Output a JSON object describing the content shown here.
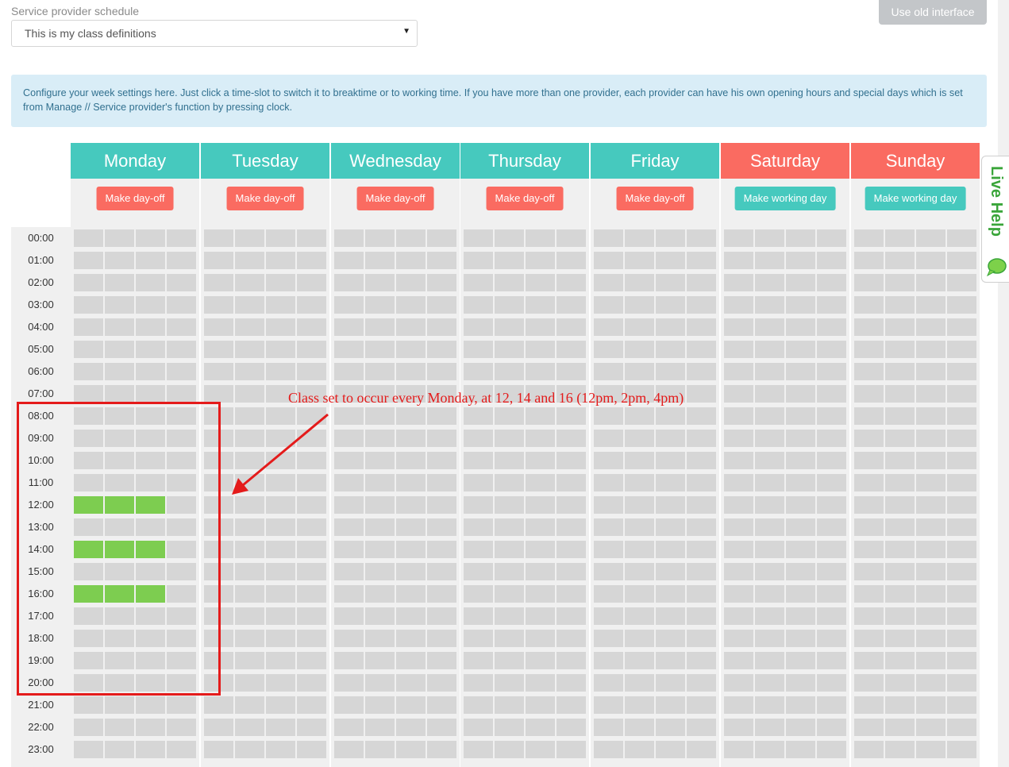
{
  "provider_field": {
    "label": "Service provider schedule",
    "selected": "This is my class definitions"
  },
  "top_button": "Use old interface",
  "info_text": "Configure your week settings here. Just click a time-slot to switch it to breaktime or to working time. If you have more than one provider, each provider can have his own opening hours and special days which is set from Manage // Service provider's function by pressing clock.",
  "times": [
    "00:00",
    "01:00",
    "02:00",
    "03:00",
    "04:00",
    "05:00",
    "06:00",
    "07:00",
    "08:00",
    "09:00",
    "10:00",
    "11:00",
    "12:00",
    "13:00",
    "14:00",
    "15:00",
    "16:00",
    "17:00",
    "18:00",
    "19:00",
    "20:00",
    "21:00",
    "22:00",
    "23:00"
  ],
  "days": [
    {
      "name": "Monday",
      "status": "working",
      "button": "Make day-off",
      "active_slots": {
        "12:00": [
          0,
          1,
          2
        ],
        "14:00": [
          0,
          1,
          2
        ],
        "16:00": [
          0,
          1,
          2
        ]
      }
    },
    {
      "name": "Tuesday",
      "status": "working",
      "button": "Make day-off",
      "active_slots": {}
    },
    {
      "name": "Wednesday",
      "status": "working",
      "button": "Make day-off",
      "active_slots": {}
    },
    {
      "name": "Thursday",
      "status": "working",
      "button": "Make day-off",
      "active_slots": {}
    },
    {
      "name": "Friday",
      "status": "working",
      "button": "Make day-off",
      "active_slots": {}
    },
    {
      "name": "Saturday",
      "status": "off",
      "button": "Make working day",
      "active_slots": {}
    },
    {
      "name": "Sunday",
      "status": "off",
      "button": "Make working day",
      "active_slots": {}
    }
  ],
  "slots_per_hour": 4,
  "annotation": "Class set to occur every Monday, at 12, 14 and 16 (12pm, 2pm, 4pm)",
  "live_help": "Live Help",
  "colors": {
    "working_header": "#46c9be",
    "off_header": "#fa6b61",
    "slot_empty": "#d6d6d6",
    "slot_active": "#7dcd50",
    "annotation": "#e41b1b"
  }
}
